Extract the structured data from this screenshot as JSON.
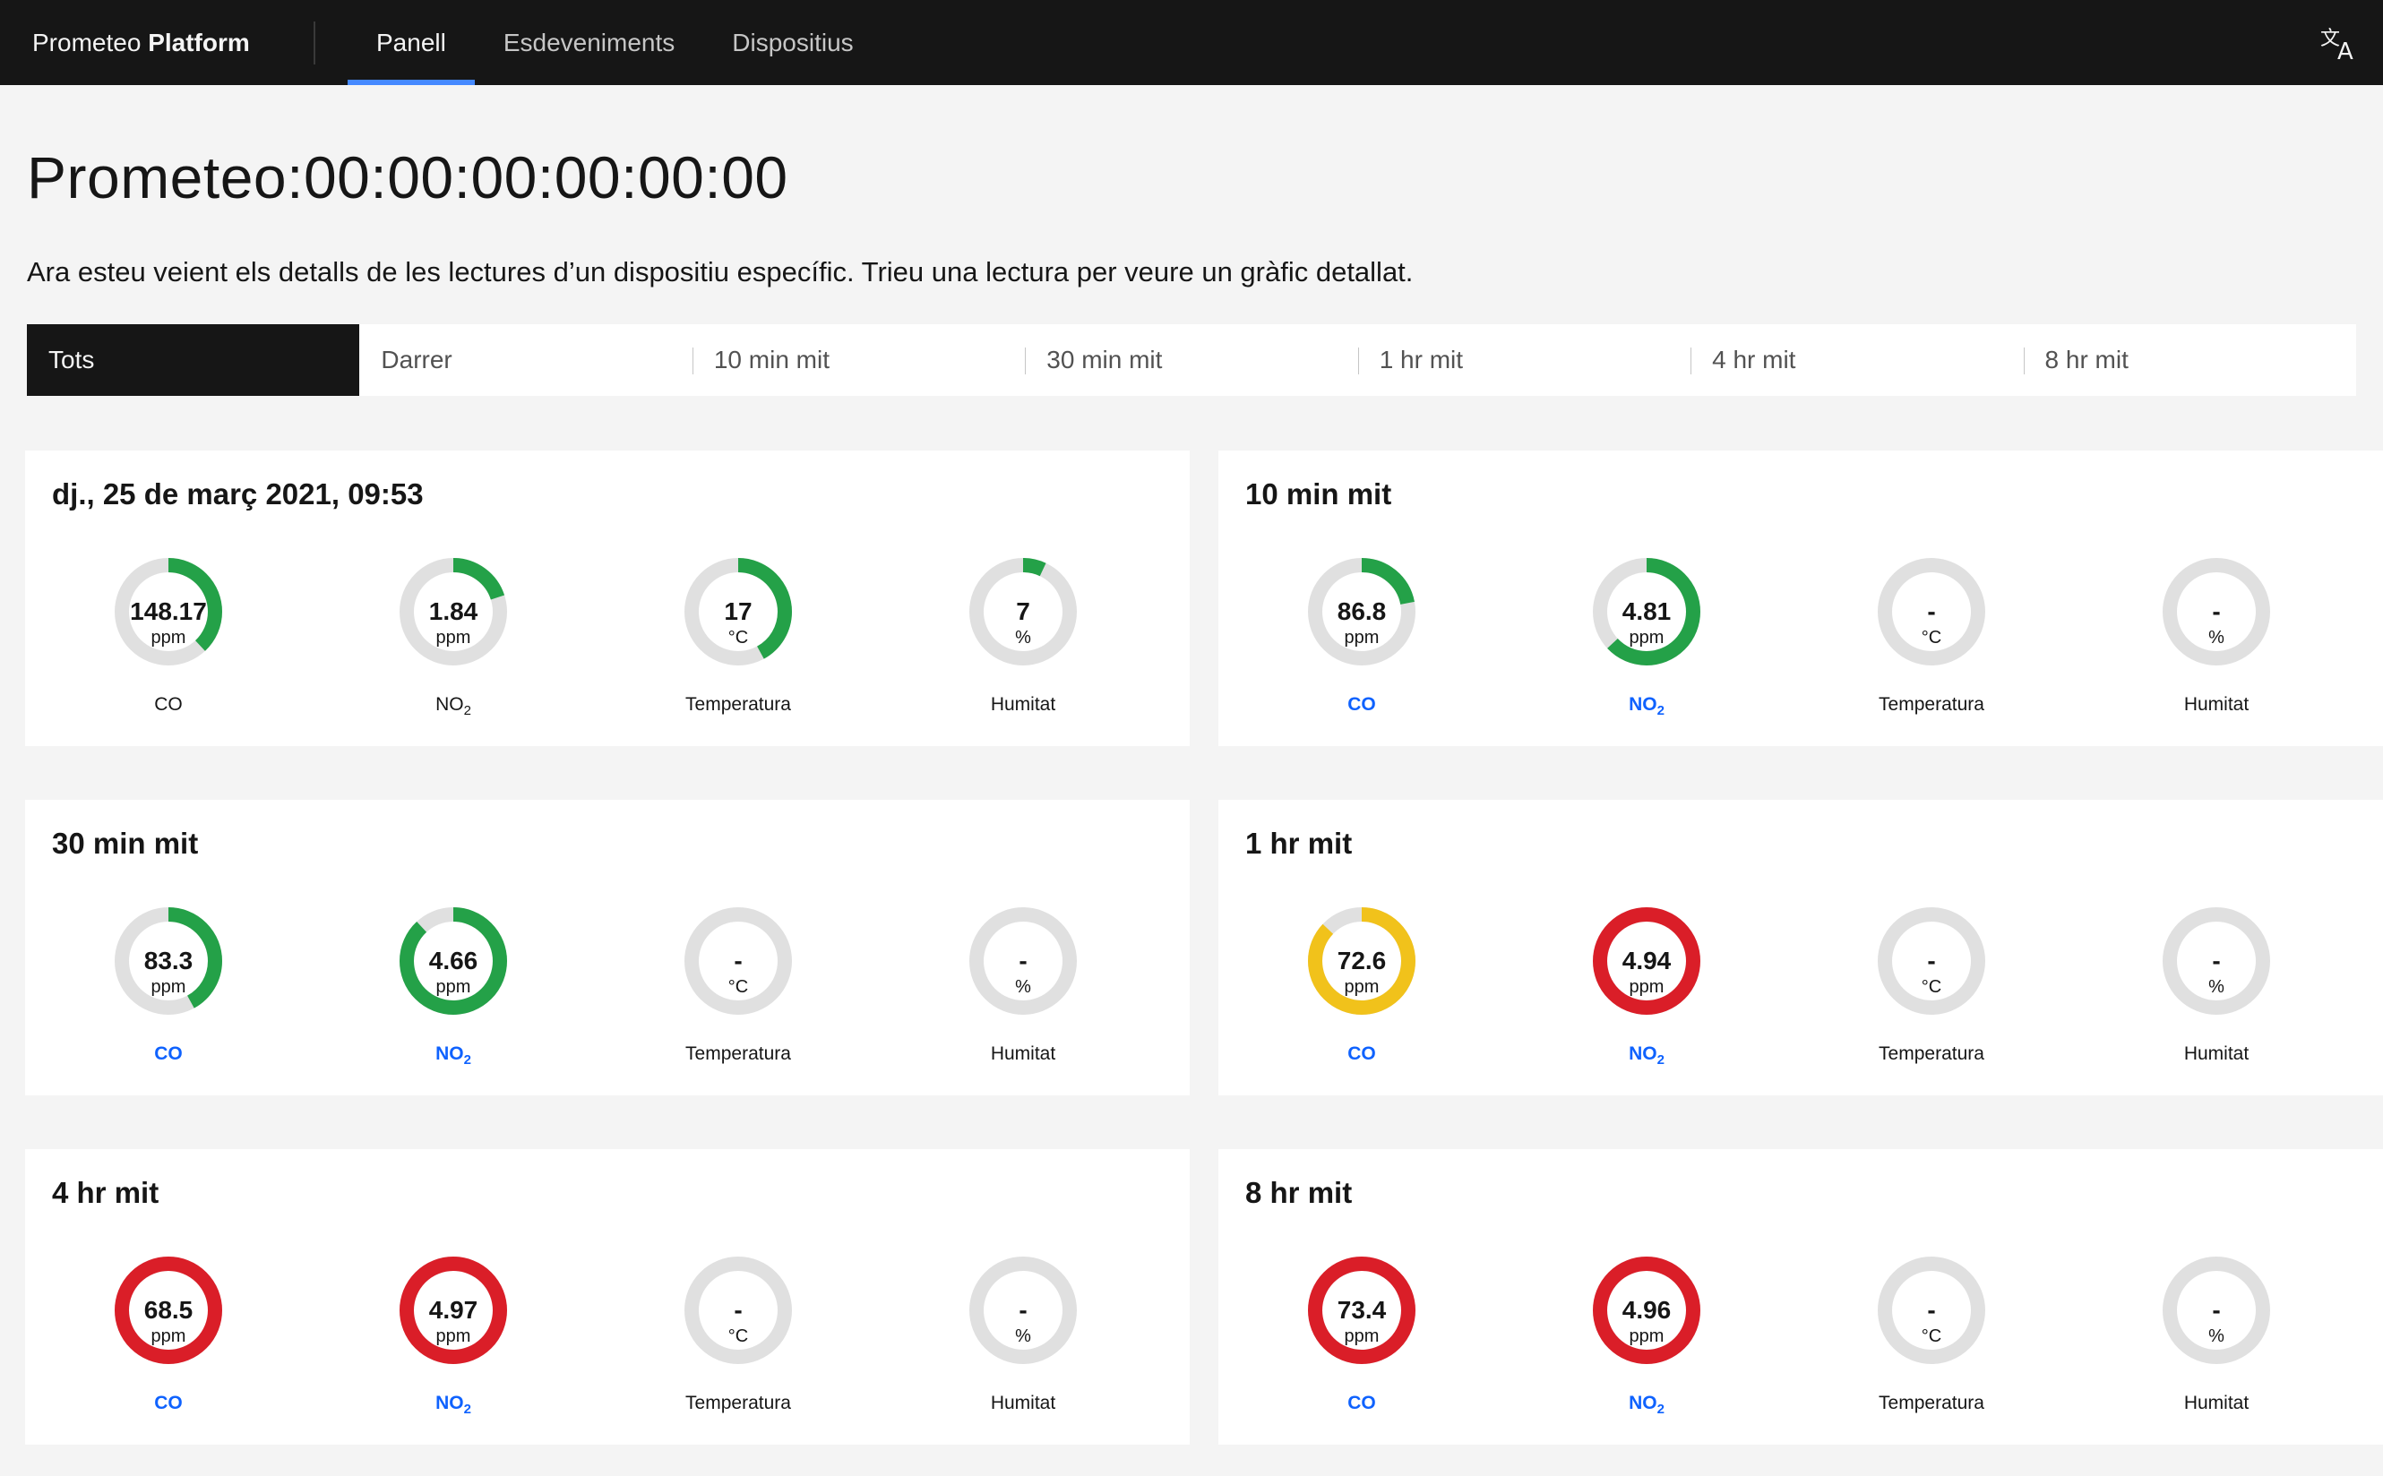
{
  "header": {
    "brand_prefix": "Prometeo",
    "brand_suffix": "Platform",
    "nav": [
      {
        "label": "Panell",
        "active": true
      },
      {
        "label": "Esdeveniments",
        "active": false
      },
      {
        "label": "Dispositius",
        "active": false
      }
    ],
    "language_icon": "translate-icon"
  },
  "page": {
    "title": "Prometeo:00:00:00:00:00:00",
    "description": "Ara esteu veient els detalls de les lectures d’un dispositiu específic. Trieu una lectura per veure un gràfic detallat."
  },
  "tabs": [
    {
      "label": "Tots",
      "active": true
    },
    {
      "label": "Darrer",
      "active": false
    },
    {
      "label": "10 min mit",
      "active": false
    },
    {
      "label": "30 min mit",
      "active": false
    },
    {
      "label": "1 hr mit",
      "active": false
    },
    {
      "label": "4 hr mit",
      "active": false
    },
    {
      "label": "8 hr mit",
      "active": false
    }
  ],
  "colors": {
    "good": "#24a148",
    "warning": "#f1c21b",
    "danger": "#da1e28",
    "track": "#e0e0e0",
    "link": "#0f62fe",
    "nav_indicator": "#4589ff"
  },
  "cards": [
    {
      "title": "dj., 25 de març 2021, 09:53",
      "readings": [
        {
          "value": "148.17",
          "unit": "ppm",
          "label": "CO",
          "sub": "",
          "fill": 0.38,
          "status": "good",
          "link": false
        },
        {
          "value": "1.84",
          "unit": "ppm",
          "label": "NO",
          "sub": "2",
          "fill": 0.2,
          "status": "good",
          "link": false
        },
        {
          "value": "17",
          "unit": "°C",
          "label": "Temperatura",
          "sub": "",
          "fill": 0.42,
          "status": "good",
          "link": false
        },
        {
          "value": "7",
          "unit": "%",
          "label": "Humitat",
          "sub": "",
          "fill": 0.07,
          "status": "good",
          "link": false
        }
      ]
    },
    {
      "title": "10 min mit",
      "readings": [
        {
          "value": "86.8",
          "unit": "ppm",
          "label": "CO",
          "sub": "",
          "fill": 0.22,
          "status": "good",
          "link": true
        },
        {
          "value": "4.81",
          "unit": "ppm",
          "label": "NO",
          "sub": "2",
          "fill": 0.63,
          "status": "good",
          "link": true
        },
        {
          "value": "-",
          "unit": "°C",
          "label": "Temperatura",
          "sub": "",
          "fill": 0,
          "status": "good",
          "link": false
        },
        {
          "value": "-",
          "unit": "%",
          "label": "Humitat",
          "sub": "",
          "fill": 0,
          "status": "good",
          "link": false
        }
      ]
    },
    {
      "title": "30 min mit",
      "readings": [
        {
          "value": "83.3",
          "unit": "ppm",
          "label": "CO",
          "sub": "",
          "fill": 0.42,
          "status": "good",
          "link": true
        },
        {
          "value": "4.66",
          "unit": "ppm",
          "label": "NO",
          "sub": "2",
          "fill": 0.88,
          "status": "good",
          "link": true
        },
        {
          "value": "-",
          "unit": "°C",
          "label": "Temperatura",
          "sub": "",
          "fill": 0,
          "status": "good",
          "link": false
        },
        {
          "value": "-",
          "unit": "%",
          "label": "Humitat",
          "sub": "",
          "fill": 0,
          "status": "good",
          "link": false
        }
      ]
    },
    {
      "title": "1 hr mit",
      "readings": [
        {
          "value": "72.6",
          "unit": "ppm",
          "label": "CO",
          "sub": "",
          "fill": 0.87,
          "status": "warning",
          "link": true
        },
        {
          "value": "4.94",
          "unit": "ppm",
          "label": "NO",
          "sub": "2",
          "fill": 1,
          "status": "danger",
          "link": true
        },
        {
          "value": "-",
          "unit": "°C",
          "label": "Temperatura",
          "sub": "",
          "fill": 0,
          "status": "good",
          "link": false
        },
        {
          "value": "-",
          "unit": "%",
          "label": "Humitat",
          "sub": "",
          "fill": 0,
          "status": "good",
          "link": false
        }
      ]
    },
    {
      "title": "4 hr mit",
      "readings": [
        {
          "value": "68.5",
          "unit": "ppm",
          "label": "CO",
          "sub": "",
          "fill": 1,
          "status": "danger",
          "link": true
        },
        {
          "value": "4.97",
          "unit": "ppm",
          "label": "NO",
          "sub": "2",
          "fill": 1,
          "status": "danger",
          "link": true
        },
        {
          "value": "-",
          "unit": "°C",
          "label": "Temperatura",
          "sub": "",
          "fill": 0,
          "status": "good",
          "link": false
        },
        {
          "value": "-",
          "unit": "%",
          "label": "Humitat",
          "sub": "",
          "fill": 0,
          "status": "good",
          "link": false
        }
      ]
    },
    {
      "title": "8 hr mit",
      "readings": [
        {
          "value": "73.4",
          "unit": "ppm",
          "label": "CO",
          "sub": "",
          "fill": 1,
          "status": "danger",
          "link": true
        },
        {
          "value": "4.96",
          "unit": "ppm",
          "label": "NO",
          "sub": "2",
          "fill": 1,
          "status": "danger",
          "link": true
        },
        {
          "value": "-",
          "unit": "°C",
          "label": "Temperatura",
          "sub": "",
          "fill": 0,
          "status": "good",
          "link": false
        },
        {
          "value": "-",
          "unit": "%",
          "label": "Humitat",
          "sub": "",
          "fill": 0,
          "status": "good",
          "link": false
        }
      ]
    }
  ]
}
